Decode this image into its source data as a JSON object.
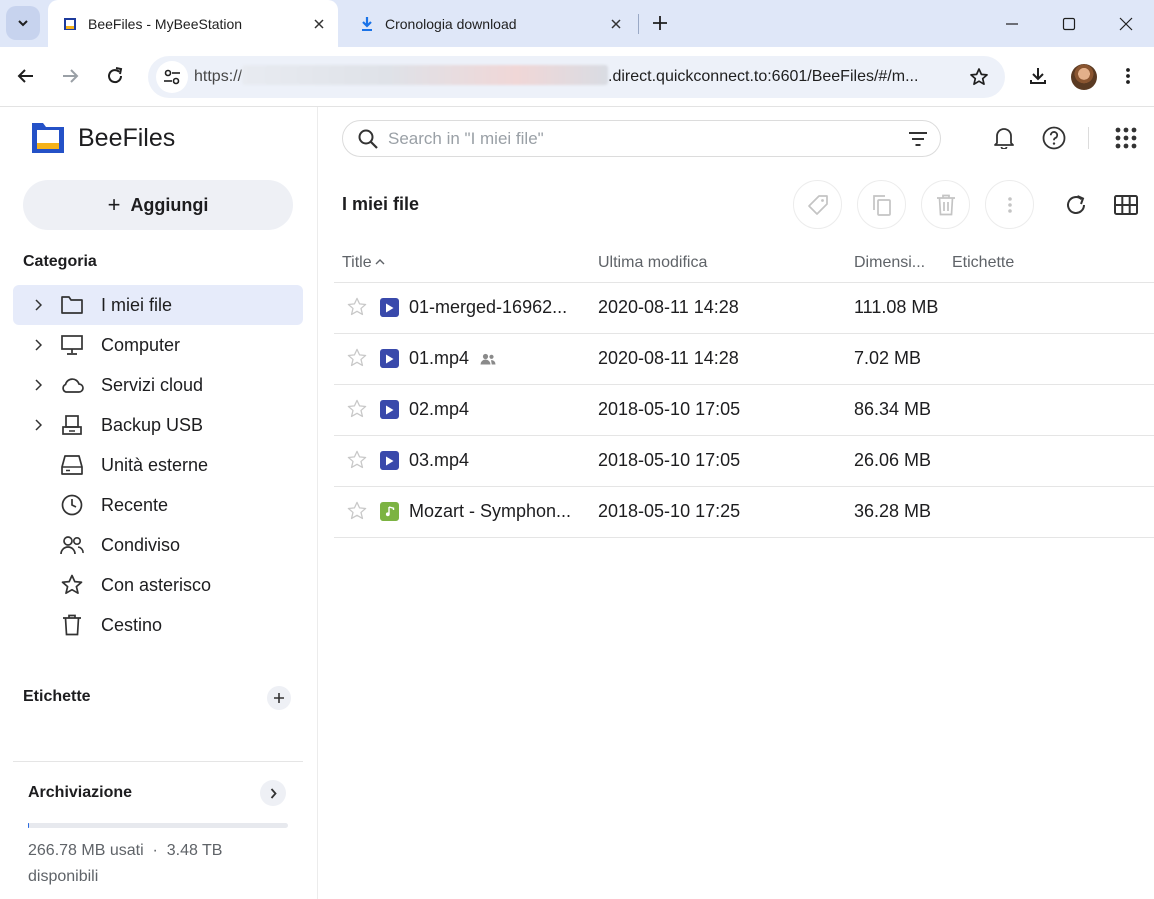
{
  "browser": {
    "tabs": [
      {
        "title": "BeeFiles - MyBeeStation",
        "favicon": "beefiles-icon",
        "active": true
      },
      {
        "title": "Cronologia download",
        "favicon": "download-icon",
        "active": false
      }
    ],
    "url_prefix": "https://",
    "url_host": ".direct.quickconnect.to:6601/BeeFiles/#/m..."
  },
  "app": {
    "name": "BeeFiles",
    "add_label": "Aggiungi",
    "colors": {
      "accent": "#2c6be0",
      "video_icon": "#3949ab",
      "audio_icon": "#7cb342",
      "active_bg": "#e6ebfa"
    }
  },
  "sidebar": {
    "category_title": "Categoria",
    "items": [
      {
        "label": "I miei file",
        "icon": "folder-icon",
        "expandable": true,
        "active": true
      },
      {
        "label": "Computer",
        "icon": "computer-icon",
        "expandable": true,
        "active": false
      },
      {
        "label": "Servizi cloud",
        "icon": "cloud-icon",
        "expandable": true,
        "active": false
      },
      {
        "label": "Backup USB",
        "icon": "usb-backup-icon",
        "expandable": true,
        "active": false
      },
      {
        "label": "Unità esterne",
        "icon": "external-drive-icon",
        "expandable": false,
        "active": false
      },
      {
        "label": "Recente",
        "icon": "clock-icon",
        "expandable": false,
        "active": false
      },
      {
        "label": "Condiviso",
        "icon": "people-icon",
        "expandable": false,
        "active": false
      },
      {
        "label": "Con asterisco",
        "icon": "star-icon",
        "expandable": false,
        "active": false
      },
      {
        "label": "Cestino",
        "icon": "trash-icon",
        "expandable": false,
        "active": false
      }
    ],
    "labels_title": "Etichette",
    "storage": {
      "title": "Archiviazione",
      "used_text": "266.78 MB usati",
      "separator": "·",
      "available_text": "3.48 TB disponibili",
      "used_fraction": 0.0001
    }
  },
  "main": {
    "search_placeholder": "Search in \"I miei file\"",
    "page_title": "I miei file",
    "columns": {
      "title": "Title",
      "modified": "Ultima modifica",
      "size": "Dimensi...",
      "labels": "Etichette"
    },
    "sort": {
      "column": "title",
      "direction": "ascending"
    },
    "files": [
      {
        "name": "01-merged-16962...",
        "type": "video",
        "shared": false,
        "modified": "2020-08-11 14:28",
        "size": "111.08 MB"
      },
      {
        "name": "01.mp4",
        "type": "video",
        "shared": true,
        "modified": "2020-08-11 14:28",
        "size": "7.02 MB"
      },
      {
        "name": "02.mp4",
        "type": "video",
        "shared": false,
        "modified": "2018-05-10 17:05",
        "size": "86.34 MB"
      },
      {
        "name": "03.mp4",
        "type": "video",
        "shared": false,
        "modified": "2018-05-10 17:05",
        "size": "26.06 MB"
      },
      {
        "name": "Mozart - Symphon...",
        "type": "audio",
        "shared": false,
        "modified": "2018-05-10 17:25",
        "size": "36.28 MB"
      }
    ]
  }
}
